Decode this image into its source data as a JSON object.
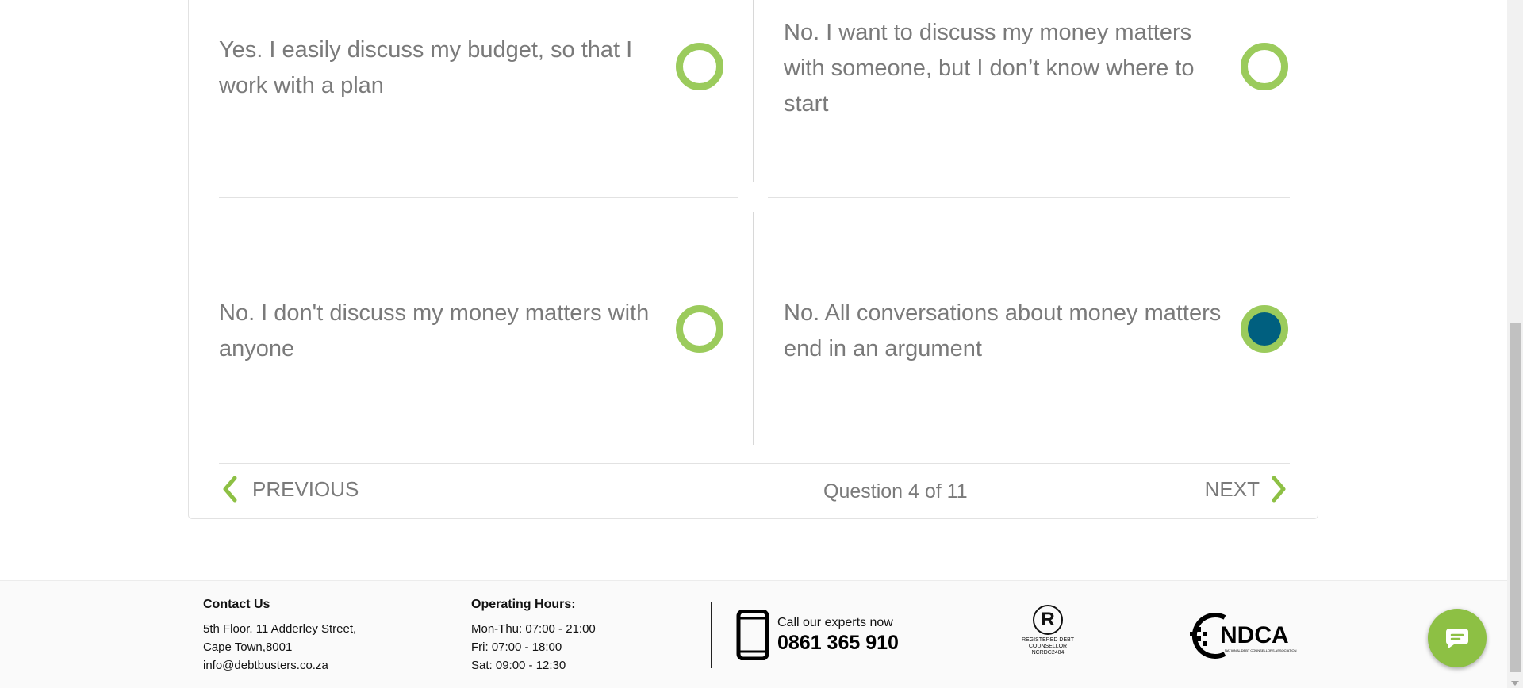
{
  "quiz": {
    "options": [
      {
        "text": "Yes. I easily discuss my budget, so that I work with a plan",
        "selected": false
      },
      {
        "text": "No. I want to discuss my money matters with someone, but I don’t know where to start",
        "selected": false
      },
      {
        "text": "No. I don't discuss my money matters with anyone",
        "selected": false
      },
      {
        "text": "No. All conversations about money matters end in an argument",
        "selected": true
      }
    ],
    "nav": {
      "previous_label": "PREVIOUS",
      "next_label": "NEXT",
      "progress": "Question 4 of 11"
    },
    "colors": {
      "radio_ring": "#9bcb5c",
      "radio_selected_fill": "#005f7f",
      "chevron": "#8dc044"
    }
  },
  "footer": {
    "contact": {
      "title": "Contact Us",
      "address_line1": "5th Floor. 11 Adderley Street,",
      "address_line2": "Cape Town,8001",
      "email": "info@debtbusters.co.za"
    },
    "hours": {
      "title": "Operating Hours:",
      "mon_thu": "Mon-Thu: 07:00 - 21:00",
      "fri": "Fri: 07:00 - 18:00",
      "sat": "Sat: 09:00 - 12:30"
    },
    "call": {
      "label": "Call our experts now",
      "number": "0861 365 910",
      "icon": "mobile-phone-icon"
    },
    "registered_badge": {
      "symbol": "R",
      "line1": "Registered Debt",
      "line2": "Counsellor",
      "line3": "NCRDC2484"
    },
    "ndca_logo": {
      "text": "NDCA",
      "subtext": "National Debt Counsellors Association"
    }
  },
  "chat": {
    "icon": "chat-bubble-icon",
    "color": "#8dc044"
  }
}
